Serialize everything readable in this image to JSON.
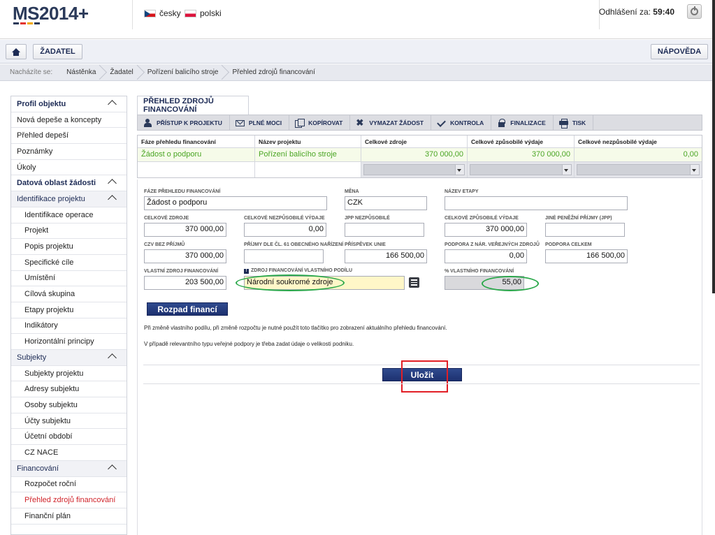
{
  "header": {
    "logo_text": "MS2014+",
    "langs": [
      {
        "label": "česky"
      },
      {
        "label": "polski"
      }
    ],
    "logout_label": "Odhlášení za:",
    "logout_time": "59:40"
  },
  "navbar": {
    "zadatel_label": "ŽADATEL",
    "napoveda_label": "NÁPOVĚDA"
  },
  "breadcrumb": {
    "label": "Nacházíte se:",
    "items": [
      "Nástěnka",
      "Žadatel",
      "Pořízení balicího stroje",
      "Přehled zdrojů financování"
    ]
  },
  "sidebar": {
    "profil_head": "Profil objektu",
    "profil_items": [
      "Nová depeše a koncepty",
      "Přehled depeší",
      "Poznámky",
      "Úkoly"
    ],
    "datova_head": "Datová oblast žádosti",
    "identifikace_head": "Identifikace projektu",
    "identifikace_items": [
      "Identifikace operace",
      "Projekt",
      "Popis projektu",
      "Specifické cíle",
      "Umístění",
      "Cílová skupina",
      "Etapy projektu",
      "Indikátory",
      "Horizontální principy"
    ],
    "subjekty_head": "Subjekty",
    "subjekty_items": [
      "Subjekty projektu",
      "Adresy subjektu",
      "Osoby subjektu",
      "Účty subjektu",
      "Účetní období",
      "CZ NACE"
    ],
    "financovani_head": "Financování",
    "financovani_items": [
      "Rozpočet roční",
      "Přehled zdrojů financování",
      "Finanční plán"
    ]
  },
  "main": {
    "tab_title": "PŘEHLED ZDROJŮ FINANCOVÁNÍ",
    "toolbar": [
      "PŘÍSTUP K PROJEKTU",
      "PLNÉ MOCI",
      "KOPÍROVAT",
      "VYMAZAT ŽÁDOST",
      "KONTROLA",
      "FINALIZACE",
      "TISK"
    ],
    "grid": {
      "headers": [
        "Fáze přehledu financování",
        "Název projektu",
        "Celkové zdroje",
        "Celkové způsobilé výdaje",
        "Celkové nezpůsobilé výdaje"
      ],
      "row": [
        "Žádost o podporu",
        "Pořízení balicího stroje",
        "370 000,00",
        "370 000,00",
        "0,00"
      ]
    },
    "form": {
      "faze_label": "FÁZE PŘEHLEDU FINANCOVÁNÍ",
      "faze_value": "Žádost o podporu",
      "mena_label": "MĚNA",
      "mena_value": "CZK",
      "etapa_label": "NÁZEV ETAPY",
      "etapa_value": "",
      "celk_zdroje_label": "CELKOVÉ ZDROJE",
      "celk_zdroje_value": "370 000,00",
      "celk_nezp_label": "CELKOVÉ NEZPŮSOBILÉ VÝDAJE",
      "celk_nezp_value": "0,00",
      "jpp_nezp_label": "JPP NEZPŮSOBILÉ",
      "jpp_nezp_value": "",
      "celk_zp_label": "CELKOVÉ ZPŮSOBILÉ VÝDAJE",
      "celk_zp_value": "370 000,00",
      "jine_label": "JINÉ PENĚŽNÍ PŘÍJMY (JPP)",
      "jine_value": "",
      "czv_label": "CZV BEZ PŘÍJMŮ",
      "czv_value": "370 000,00",
      "prijmy_label": "PŘÍJMY DLE ČL. 61 OBECNÉHO NAŘÍZENÍ",
      "prijmy_value": "",
      "prispevek_label": "PŘÍSPĚVEK UNIE",
      "prispevek_value": "166 500,00",
      "podpora_nar_label": "PODPORA Z NÁR. VEŘEJNÝCH ZDROJŮ",
      "podpora_nar_value": "0,00",
      "podpora_celk_label": "PODPORA CELKEM",
      "podpora_celk_value": "166 500,00",
      "vlastni_label": "VLASTNÍ ZDROJ FINANCOVÁNÍ",
      "vlastni_value": "203 500,00",
      "zdroj_label": "ZDROJ FINANCOVÁNÍ VLASTNÍHO PODÍLU",
      "zdroj_value": "Národní soukromé zdroje",
      "procento_label": "% VLASTNÍHO FINANCOVÁNÍ",
      "procento_value": "55,00",
      "rozpad_label": "Rozpad financí",
      "note1": "Při změně vlastního podílu, při změně rozpočtu je nutné použít toto tlačítko pro zobrazení aktuálního přehledu financování.",
      "note2": "V případě relevantního typu veřejné podpory je třeba zadat údaje o velikosti podniku.",
      "ulozit_label": "Uložit"
    }
  },
  "colors": {
    "navy": "#1d2b55",
    "green_text": "#4aa524",
    "highlight_red": "#e21f26",
    "highlight_green": "#2aa84a"
  }
}
